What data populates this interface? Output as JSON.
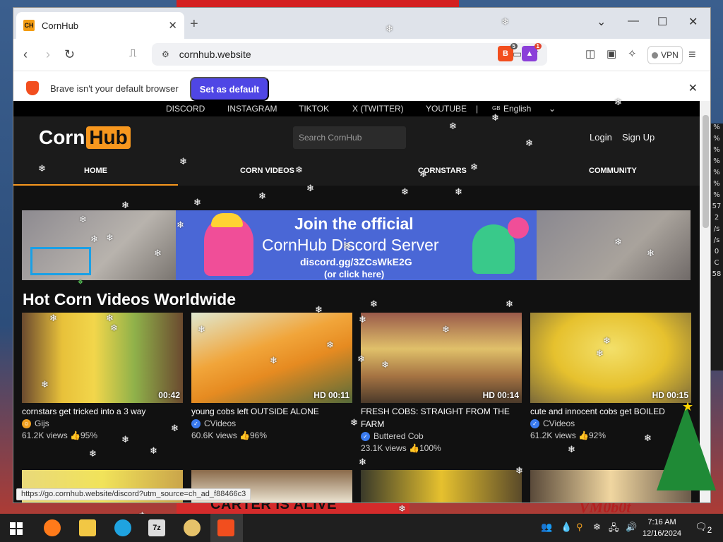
{
  "desktop": {
    "bottom_text": "CARTER IS ALIVE",
    "signature": "VM0b0t",
    "side_values": [
      "%",
      "%",
      "%",
      "%",
      "%",
      "%",
      "%",
      "57",
      "2",
      "/s",
      "/s",
      "0",
      "C",
      "58"
    ]
  },
  "browser": {
    "tab": {
      "favicon": "CH",
      "title": "CornHub"
    },
    "url": "cornhub.website",
    "shield_badge": "5",
    "reward_badge": "1",
    "vpn_label": "VPN",
    "infobar": {
      "text": "Brave isn't your default browser",
      "button": "Set as default"
    },
    "status_link": "https://go.cornhub.website/discord?utm_source=ch_ad_f88466c3"
  },
  "site": {
    "social": {
      "discord": "DISCORD",
      "instagram": "INSTAGRAM",
      "tiktok": "TIKTOK",
      "twitter": "X (TWITTER)",
      "youtube": "YOUTUBE",
      "divider": "|",
      "lang_flag": "GB",
      "lang": "English"
    },
    "logo": {
      "part1": "Corn",
      "part2": "Hub"
    },
    "search_placeholder": "Search CornHub",
    "login": "Login",
    "signup": "Sign Up",
    "nav": {
      "home": "HOME",
      "videos": "CORN VIDEOS",
      "stars": "CORNSTARS",
      "community": "COMMUNITY"
    },
    "banner": {
      "title": "Join the official",
      "subtitle": "CornHub Discord Server",
      "link": "discord.gg/3ZCsWkE2G",
      "link2": "(or click here)"
    },
    "section_title": "Hot Corn Videos Worldwide",
    "videos": [
      {
        "duration": "00:42",
        "title": "cornstars get tricked into a 3 way",
        "channel": "Gijs",
        "views": "61.2K views",
        "rating": "95%"
      },
      {
        "duration": "HD 00:11",
        "title": "young cobs left OUTSIDE ALONE",
        "channel": "CVideos",
        "views": "60.6K views",
        "rating": "96%"
      },
      {
        "duration": "HD 00:14",
        "title": "FRESH COBS: STRAIGHT FROM THE FARM",
        "channel": "Buttered Cob",
        "views": "23.1K views",
        "rating": "100%"
      },
      {
        "duration": "HD 00:15",
        "title": "cute and innocent cobs get BOILED",
        "channel": "CVideos",
        "views": "61.2K views",
        "rating": "92%"
      }
    ]
  },
  "taskbar": {
    "time": "7:16 AM",
    "date": "12/16/2024",
    "notifications": "2",
    "sevenzip_label": "7z"
  },
  "colors": {
    "accent": "#f7971e",
    "brave_button": "#4f46e5",
    "banner_bg": "#4a67d6",
    "site_bg": "#111111"
  }
}
